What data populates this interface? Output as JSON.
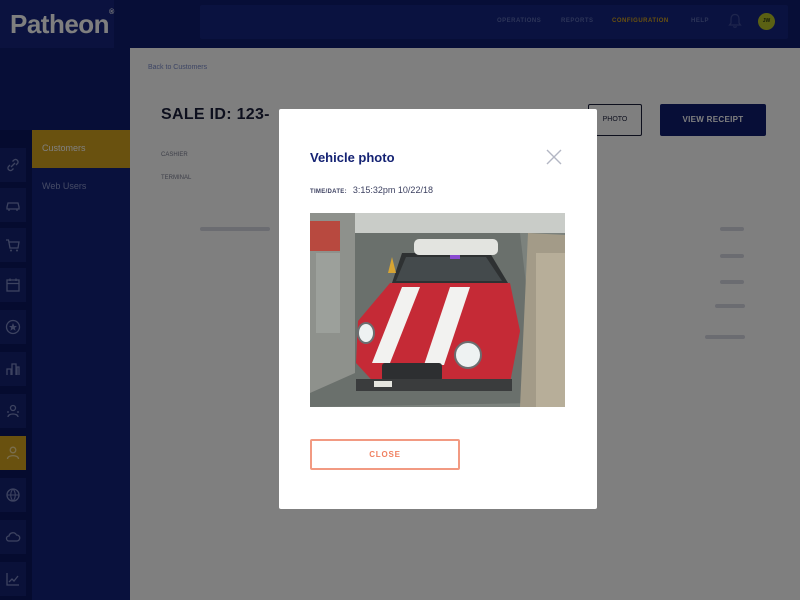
{
  "app": {
    "logo": "Patheon",
    "logo_mark": "®"
  },
  "topnav": {
    "items": [
      {
        "label": "OPERATIONS",
        "active": false
      },
      {
        "label": "REPORTS",
        "active": false
      },
      {
        "label": "CONFIGURATION",
        "active": true
      },
      {
        "label": "HELP",
        "active": false
      }
    ],
    "bell_icon": "bell-icon",
    "avatar_initials": "JW",
    "active_color": "#d3a21e"
  },
  "sidebar": {
    "rail_icons": [
      {
        "name": "link-icon",
        "active": false
      },
      {
        "name": "car-icon",
        "active": false
      },
      {
        "name": "cart-icon",
        "active": false
      },
      {
        "name": "calendar-icon",
        "active": false
      },
      {
        "name": "star-badge-icon",
        "active": false
      },
      {
        "name": "inventory-icon",
        "active": false
      },
      {
        "name": "users-icon",
        "active": false
      },
      {
        "name": "customer-icon",
        "active": true
      },
      {
        "name": "globe-icon",
        "active": false
      },
      {
        "name": "cloud-icon",
        "active": false
      },
      {
        "name": "chart-icon",
        "active": false
      }
    ],
    "submenu": [
      {
        "label": "Customers",
        "active": true
      },
      {
        "label": "Web Users",
        "active": false
      }
    ]
  },
  "main": {
    "breadcrumb": "Back to Customers",
    "sale_title": "SALE ID: 123-",
    "outline_button": "PHOTO",
    "receipt_button": "VIEW RECEIPT",
    "field_labels": [
      "CASHIER",
      "TERMINAL"
    ]
  },
  "modal": {
    "title": "Vehicle photo",
    "timestamp_label": "TIME/DATE:",
    "timestamp_value": "3:15:32pm 10/22/18",
    "close_button": "CLOSE",
    "close_icon": "close-icon",
    "accent_color": "#f08060",
    "title_color": "#142273"
  }
}
